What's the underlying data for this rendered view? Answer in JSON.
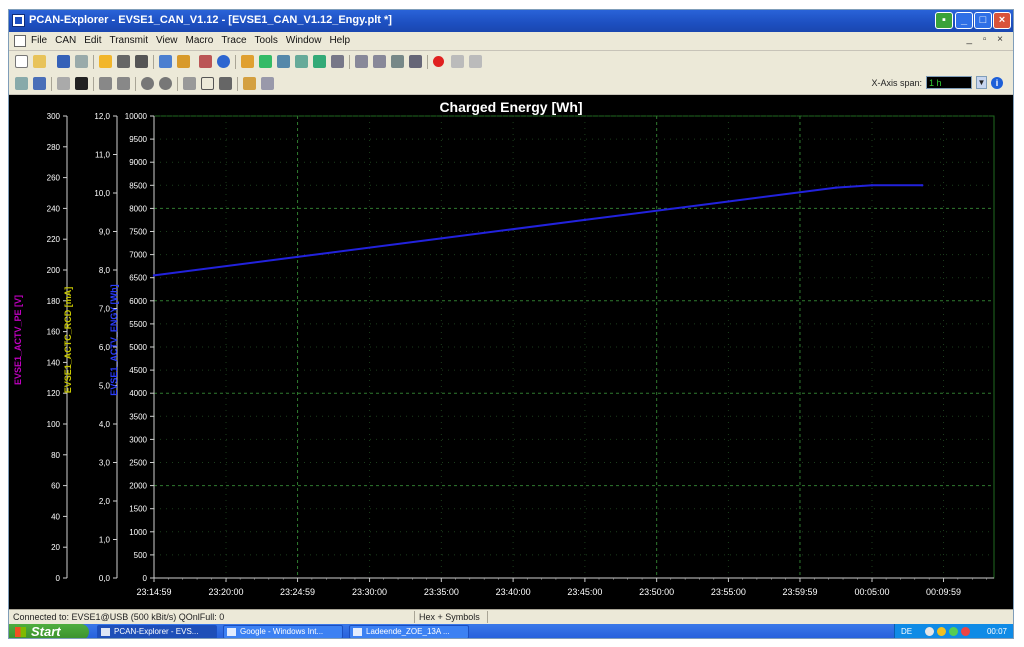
{
  "window": {
    "title": "PCAN-Explorer - EVSE1_CAN_V1.12 - [EVSE1_CAN_V1.12_Engy.plt *]",
    "controls": [
      "minimize-icon",
      "maximize-icon",
      "close-icon"
    ]
  },
  "menubar": {
    "items": [
      "File",
      "CAN",
      "Edit",
      "Transmit",
      "View",
      "Macro",
      "Trace",
      "Tools",
      "Window",
      "Help"
    ],
    "mdi_controls": "_ ▫ ×"
  },
  "toolbar": {
    "xaxis_span_label": "X-Axis span:",
    "xaxis_span_value": "1 h",
    "info_icon": "info-icon"
  },
  "chart_data": {
    "type": "line",
    "title": "Charged Energy [Wh]",
    "x_tick_labels": [
      "23:14:59",
      "23:20:00",
      "23:24:59",
      "23:30:00",
      "23:35:00",
      "23:40:00",
      "23:45:00",
      "23:50:00",
      "23:55:00",
      "23:59:59",
      "00:05:00",
      "00:09:59"
    ],
    "axes": [
      {
        "label": "EVSE1_ACTV_PE [V]",
        "color": "#c000c0",
        "range": [
          0,
          300
        ],
        "ticks": [
          "300",
          "280",
          "260",
          "240",
          "220",
          "200",
          "180",
          "160",
          "140",
          "120",
          "100",
          "80",
          "60",
          "40",
          "20",
          "0"
        ]
      },
      {
        "label": "EVSE1_ACTC_RCD [mA]",
        "color": "#c8c800",
        "range": [
          0,
          12
        ],
        "ticks": [
          "12,0",
          "11,0",
          "10,0",
          "9,0",
          "8,0",
          "7,0",
          "6,0",
          "5,0",
          "4,0",
          "3,0",
          "2,0",
          "1,0",
          "0,0"
        ]
      },
      {
        "label": "EVSE1_ACTV_ENGY [Wh]",
        "color": "#2a3cff",
        "range": [
          0,
          10000
        ],
        "ticks": [
          "10000",
          "9500",
          "9000",
          "8500",
          "8000",
          "7500",
          "7000",
          "6500",
          "6000",
          "5500",
          "5000",
          "4500",
          "4000",
          "3500",
          "3000",
          "2500",
          "2000",
          "1500",
          "1000",
          "500",
          "0"
        ]
      }
    ],
    "series": [
      {
        "name": "EVSE1_ACTV_ENGY [Wh]",
        "color": "#2222dd",
        "x": [
          "23:14:59",
          "23:24:59",
          "23:35:00",
          "23:45:00",
          "23:55:00",
          "00:02:30",
          "00:05:00",
          "00:08:30"
        ],
        "values": [
          6550,
          6950,
          7350,
          7750,
          8150,
          8450,
          8500,
          8500
        ]
      }
    ],
    "x_range": [
      "23:14:59",
      "00:13:30"
    ],
    "grid": true,
    "background": "#000000"
  },
  "statusbar": {
    "connection": "Connected to: EVSE1@USB (500 kBit/s)  QOnlFull: 0",
    "mode": "Hex + Symbols"
  },
  "taskbar": {
    "start_label": "Start",
    "tasks": [
      "PCAN-Explorer - EVS...",
      "Google - Windows Int...",
      "Ladeende_ZOE_13A ..."
    ],
    "tray_lang": "DE",
    "clock": "00:07"
  }
}
